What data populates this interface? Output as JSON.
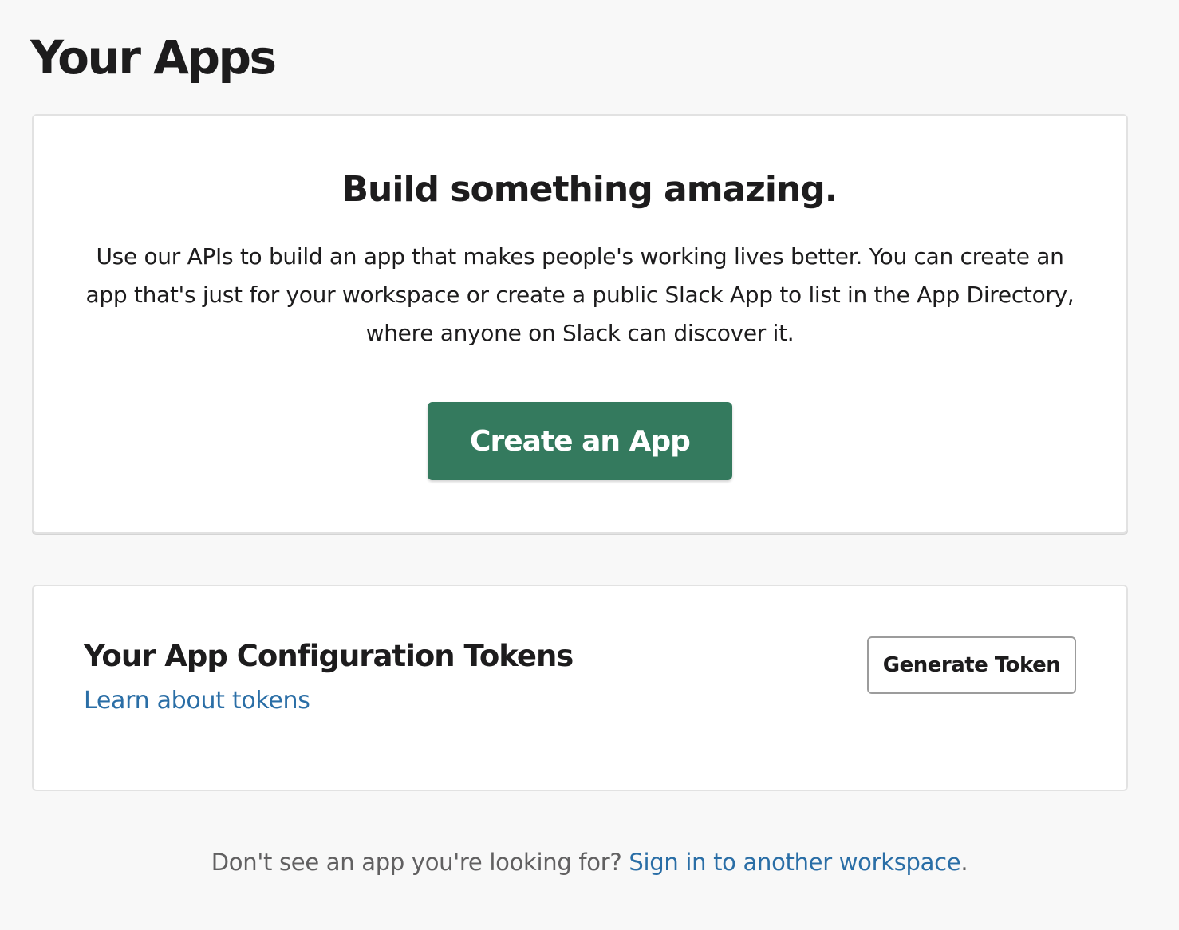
{
  "header": {
    "title": "Your Apps"
  },
  "hero": {
    "heading": "Build something amazing.",
    "description": "Use our APIs to build an app that makes people's working lives better. You can create an app that's just for your workspace or create a public Slack App to list in the App Directory, where anyone on Slack can discover it.",
    "create_button_label": "Create an App"
  },
  "tokens": {
    "heading": "Your App Configuration Tokens",
    "learn_link": "Learn about tokens",
    "generate_button_label": "Generate Token"
  },
  "footer": {
    "prompt": "Don't see an app you're looking for? ",
    "signin_link": "Sign in to another workspace",
    "period": "."
  },
  "colors": {
    "primary_button": "#347a5e",
    "link": "#2a6ea6",
    "page_background": "#f8f8f8"
  }
}
